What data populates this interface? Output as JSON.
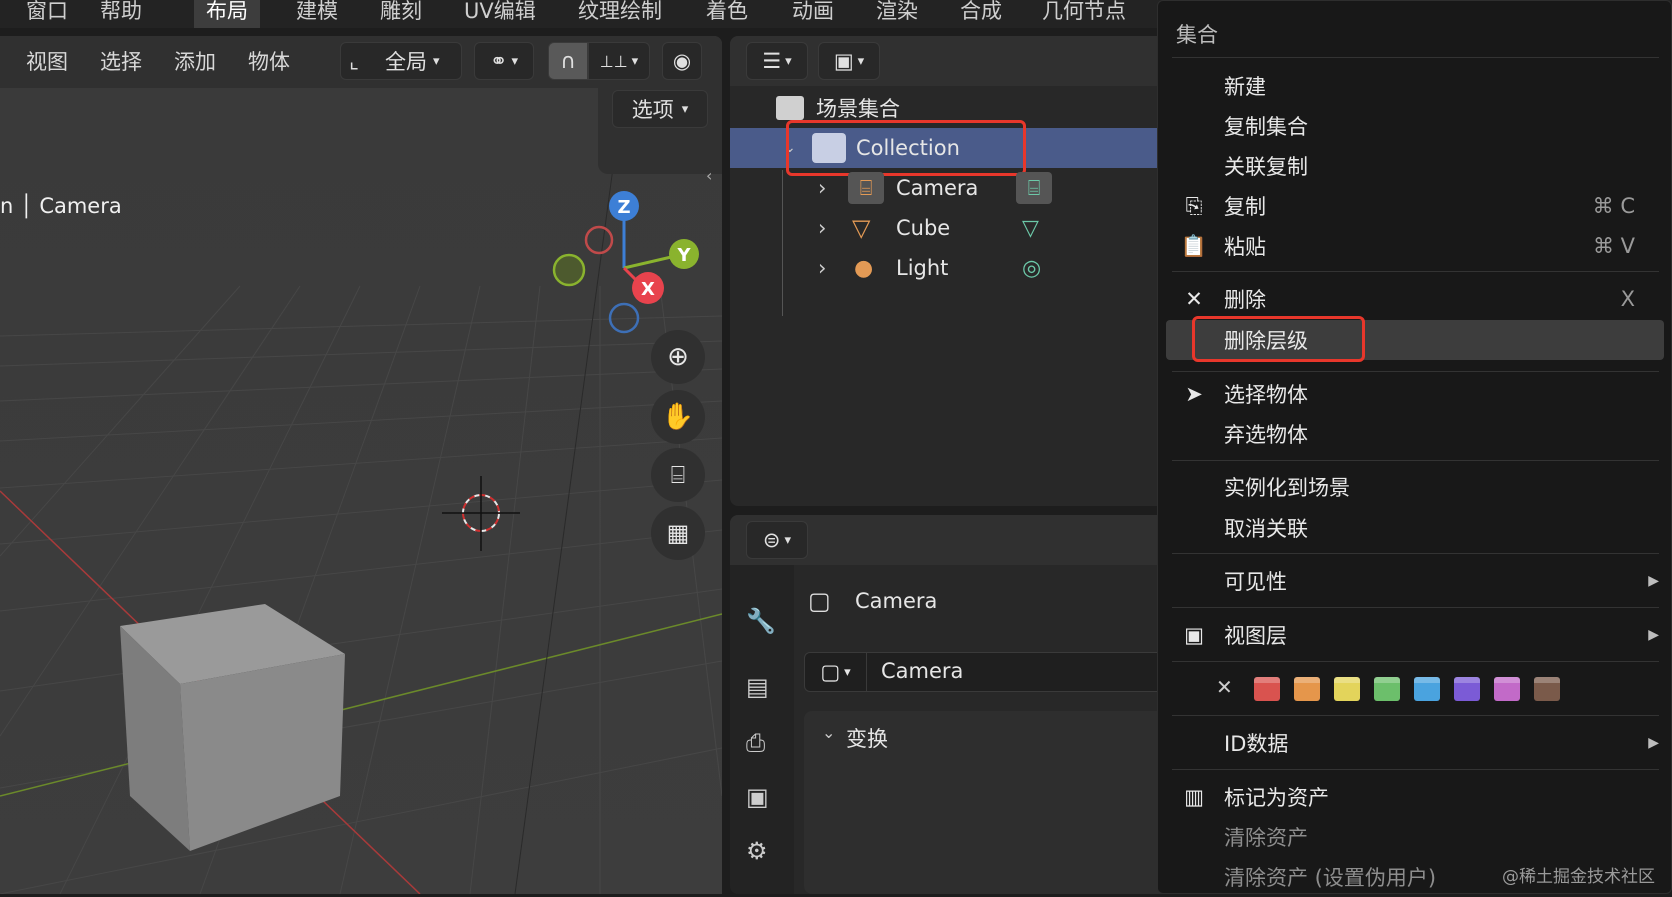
{
  "topbar": {
    "items": [
      "窗口",
      "帮助",
      "布局",
      "建模",
      "雕刻",
      "UV编辑",
      "纹理绘制",
      "着色",
      "动画",
      "渲染",
      "合成",
      "几何节点"
    ],
    "active": "布局"
  },
  "viewport": {
    "menus": [
      "视图",
      "选择",
      "添加",
      "物体"
    ],
    "transform_space": "全局",
    "options_label": "选项",
    "overlay_text_prefix": "n",
    "overlay_text": "Camera",
    "gizmo": {
      "x": "X",
      "y": "Y",
      "z": "Z"
    },
    "axis_colors": {
      "x": "#e8434d",
      "y": "#8ab32e",
      "z": "#3d7fd6"
    }
  },
  "outliner": {
    "root": "场景集合",
    "collection": "Collection",
    "objects": [
      {
        "name": "Camera",
        "icon": "camera-icon",
        "data_icon": "camera-data-icon"
      },
      {
        "name": "Cube",
        "icon": "mesh-icon",
        "data_icon": "mesh-data-icon"
      },
      {
        "name": "Light",
        "icon": "light-icon",
        "data_icon": "light-data-icon"
      }
    ],
    "selected_color": "#4a5b8a"
  },
  "properties": {
    "object_name": "Camera",
    "name_field": "Camera",
    "panel": "变换"
  },
  "context_menu": {
    "title": "集合",
    "items": {
      "new": "新建",
      "duplicate_collection": "复制集合",
      "duplicate_linked": "关联复制",
      "copy": "复制",
      "copy_shortcut": "⌘ C",
      "paste": "粘贴",
      "paste_shortcut": "⌘ V",
      "delete": "删除",
      "delete_shortcut": "X",
      "delete_hierarchy": "删除层级",
      "select_objects": "选择物体",
      "deselect_objects": "弃选物体",
      "instance_to_scene": "实例化到场景",
      "unlink": "取消关联",
      "visibility": "可见性",
      "view_layer": "视图层",
      "id_data": "ID数据",
      "mark_asset": "标记为资产",
      "clear_asset": "清除资产",
      "clear_asset_fake_user": "清除资产 (设置伪用户)"
    },
    "color_tags": [
      "#d9534f",
      "#e5964b",
      "#e3d45b",
      "#6cbf6b",
      "#4aa3df",
      "#7b5bd6",
      "#c26ac8",
      "#7a5a4a"
    ],
    "highlight_color": "#e8372b"
  },
  "watermark": "@稀土掘金技术社区"
}
